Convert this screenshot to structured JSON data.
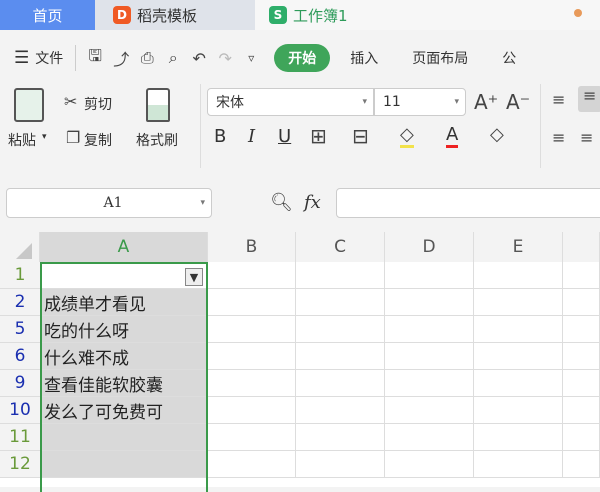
{
  "tabs": {
    "home": "首页",
    "template": "稻壳模板",
    "workbook": "工作簿1",
    "template_logo": "D",
    "workbook_logo": "S"
  },
  "menu": {
    "file": "文件",
    "start": "开始",
    "insert": "插入",
    "page_layout": "页面布局",
    "formula": "公"
  },
  "ribbon": {
    "paste": "粘贴",
    "cut": "剪切",
    "copy": "复制",
    "format_painter": "格式刷",
    "font_name": "宋体",
    "font_size": "11",
    "bold": "B",
    "italic": "I",
    "underline": "U",
    "font_color": "A"
  },
  "formula_bar": {
    "name_box": "A1",
    "fx": "fx",
    "formula": ""
  },
  "columns": [
    "A",
    "B",
    "C",
    "D",
    "E"
  ],
  "rows": [
    {
      "num": "1",
      "value": ""
    },
    {
      "num": "2",
      "value": "成绩单才看见"
    },
    {
      "num": "5",
      "value": "吃的什么呀"
    },
    {
      "num": "6",
      "value": "什么难不成"
    },
    {
      "num": "9",
      "value": "查看佳能软胶囊"
    },
    {
      "num": "10",
      "value": "发么了可免费可"
    },
    {
      "num": "11",
      "value": ""
    },
    {
      "num": "12",
      "value": ""
    }
  ],
  "colors": {
    "accent": "#3fa55a",
    "home_tab": "#5b8def",
    "row_num_filtered": "#1a2fb0",
    "row_num": "#6a9a3a"
  }
}
